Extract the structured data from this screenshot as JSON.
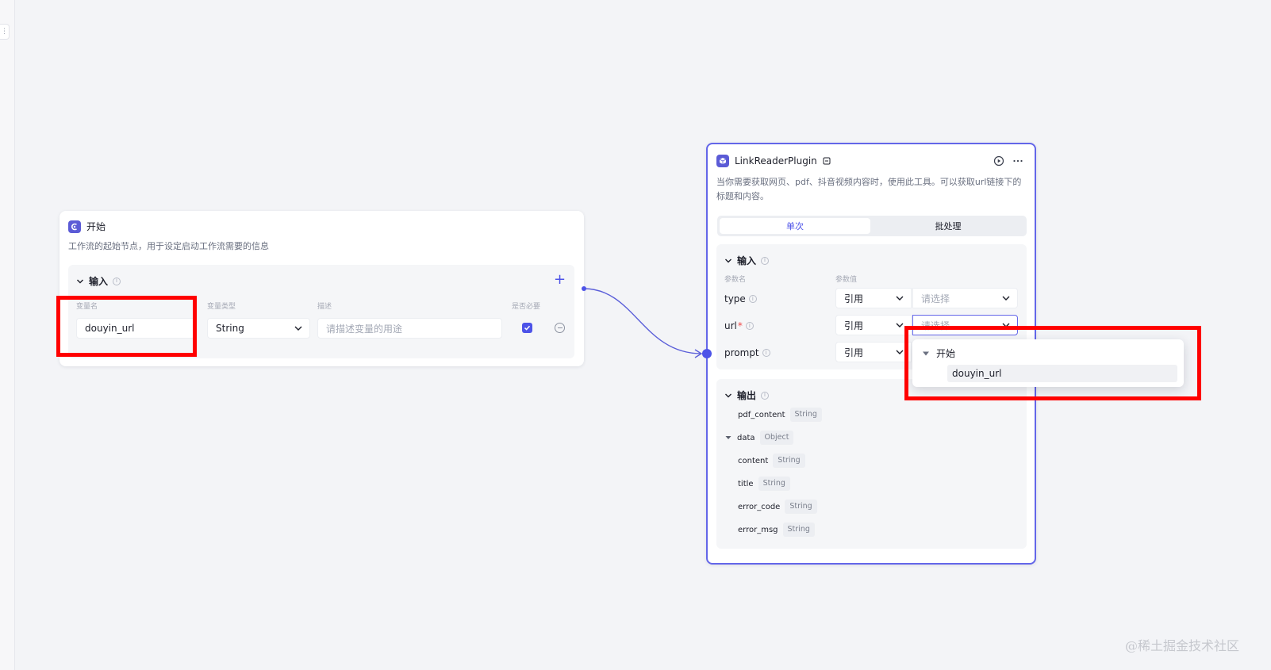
{
  "start_node": {
    "title": "开始",
    "description": "工作流的起始节点，用于设定启动工作流需要的信息",
    "input_section_label": "输入",
    "columns": {
      "var_name": "变量名",
      "var_type": "变量类型",
      "desc": "描述",
      "required": "是否必要"
    },
    "row": {
      "name": "douyin_url",
      "type": "String",
      "desc_placeholder": "请描述变量的用途",
      "required": true
    }
  },
  "plugin_node": {
    "title": "LinkReaderPlugin",
    "description": "当你需要获取网页、pdf、抖音视频内容时，使用此工具。可以获取url链接下的标题和内容。",
    "tabs": [
      {
        "label": "单次",
        "active": true
      },
      {
        "label": "批处理",
        "active": false
      }
    ],
    "input_section_label": "输入",
    "columns": {
      "param_name": "参数名",
      "param_value": "参数值"
    },
    "params": [
      {
        "name": "type",
        "required": false,
        "mode": "引用",
        "value_placeholder": "请选择"
      },
      {
        "name": "url",
        "required": true,
        "mode": "引用",
        "value_placeholder": "请选择"
      },
      {
        "name": "prompt",
        "required": false,
        "mode": "引用",
        "value_placeholder": ""
      }
    ],
    "output_section_label": "输出",
    "outputs": [
      {
        "name": "pdf_content",
        "type": "String",
        "indent": 0,
        "expandable": false
      },
      {
        "name": "data",
        "type": "Object",
        "indent": 0,
        "expandable": true
      },
      {
        "name": "content",
        "type": "String",
        "indent": 1,
        "expandable": false
      },
      {
        "name": "title",
        "type": "String",
        "indent": 1,
        "expandable": false
      },
      {
        "name": "error_code",
        "type": "String",
        "indent": 0,
        "expandable": false
      },
      {
        "name": "error_msg",
        "type": "String",
        "indent": 0,
        "expandable": false
      }
    ]
  },
  "ref_dropdown": {
    "group_label": "开始",
    "options": [
      "douyin_url"
    ]
  },
  "watermark": "@稀土掘金技术社区",
  "colors": {
    "accent": "#4d53e8",
    "node_border": "#6366e9",
    "highlight": "#ff0000",
    "canvas": "#f3f4f7"
  }
}
